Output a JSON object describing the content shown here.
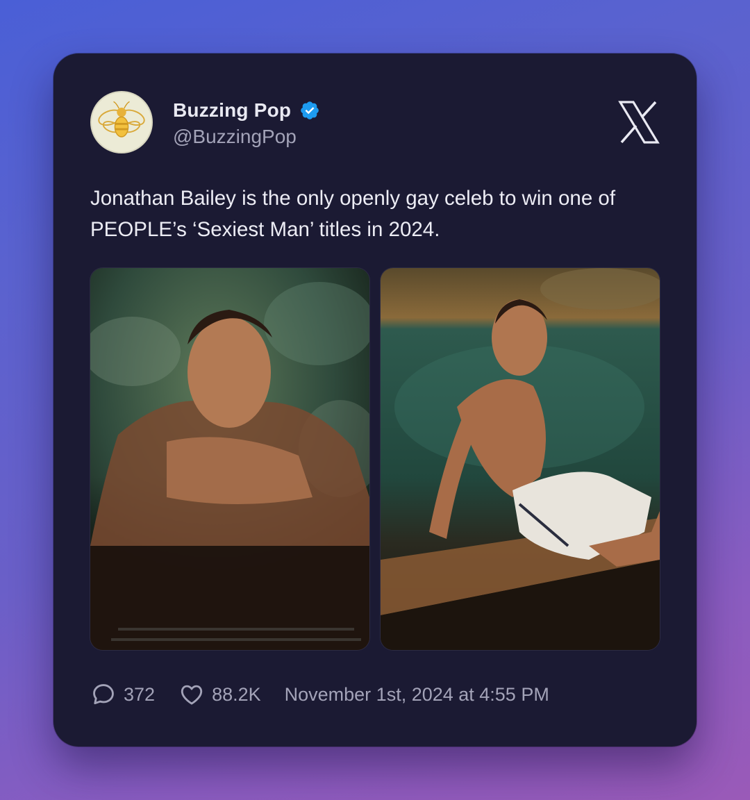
{
  "tweet": {
    "author": {
      "display_name": "Buzzing Pop",
      "handle": "@BuzzingPop",
      "verified": true,
      "avatar_icon": "bee-icon"
    },
    "platform_icon": "x-logo-icon",
    "text": "Jonathan Bailey is the only openly gay celeb to win one of PEOPLE’s ‘Sexiest Man’ titles in 2024.",
    "media": [
      {
        "kind": "photo"
      },
      {
        "kind": "photo"
      }
    ],
    "stats": {
      "replies": "372",
      "likes": "88.2K",
      "reply_icon": "comment-bubble-icon",
      "like_icon": "heart-icon"
    },
    "timestamp": "November 1st, 2024 at 4:55 PM"
  },
  "colors": {
    "background_start": "#4a5fd6",
    "background_end": "#9a5ab8",
    "card": "#1b1a33",
    "primary_text": "#ececf4",
    "secondary_text": "#a3a3b8",
    "verified_badge": "#1d9bf0"
  }
}
